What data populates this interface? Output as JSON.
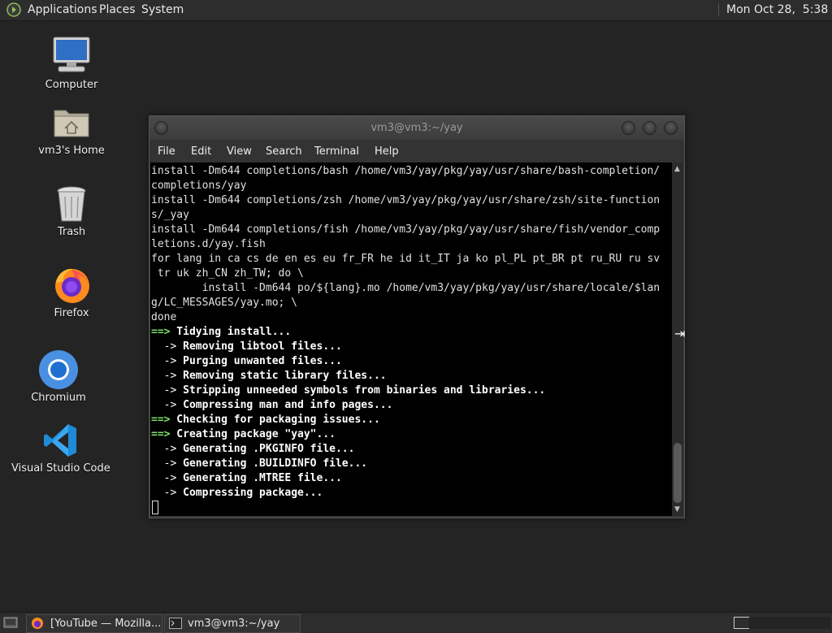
{
  "top_panel": {
    "menus": [
      "Applications",
      "Places",
      "System"
    ],
    "clock": "Mon Oct 28,  5:38 AM"
  },
  "desktop": {
    "icons": [
      {
        "label": "Computer",
        "icon": "computer-icon"
      },
      {
        "label": "vm3's Home",
        "icon": "home-folder-icon"
      },
      {
        "label": "Trash",
        "icon": "trash-icon"
      },
      {
        "label": "Firefox",
        "icon": "firefox-icon"
      },
      {
        "label": "Chromium",
        "icon": "chromium-icon"
      },
      {
        "label": "Visual Studio Code",
        "icon": "vscode-icon"
      }
    ]
  },
  "terminal": {
    "title": "vm3@vm3:~/yay",
    "menu": [
      "File",
      "Edit",
      "View",
      "Search",
      "Terminal",
      "Help"
    ],
    "lines": [
      {
        "text": "install -Dm644 completions/bash /home/vm3/yay/pkg/yay/usr/share/bash-completion/",
        "style": "plain"
      },
      {
        "text": "completions/yay",
        "style": "plain"
      },
      {
        "text": "install -Dm644 completions/zsh /home/vm3/yay/pkg/yay/usr/share/zsh/site-function",
        "style": "plain"
      },
      {
        "text": "s/_yay",
        "style": "plain"
      },
      {
        "text": "install -Dm644 completions/fish /home/vm3/yay/pkg/yay/usr/share/fish/vendor_comp",
        "style": "plain"
      },
      {
        "text": "letions.d/yay.fish",
        "style": "plain"
      },
      {
        "text": "for lang in ca cs de en es eu fr_FR he id it_IT ja ko pl_PL pt_BR pt ru_RU ru sv",
        "style": "plain"
      },
      {
        "text": " tr uk zh_CN zh_TW; do \\",
        "style": "plain"
      },
      {
        "text": "        install -Dm644 po/${lang}.mo /home/vm3/yay/pkg/yay/usr/share/locale/$lan",
        "style": "plain"
      },
      {
        "text": "g/LC_MESSAGES/yay.mo; \\",
        "style": "plain"
      },
      {
        "text": "done",
        "style": "plain"
      },
      {
        "prefix": "==>",
        "text": " Tidying install...",
        "style": "major"
      },
      {
        "prefix": "  ->",
        "text": " Removing libtool files...",
        "style": "minor"
      },
      {
        "prefix": "  ->",
        "text": " Purging unwanted files...",
        "style": "minor"
      },
      {
        "prefix": "  ->",
        "text": " Removing static library files...",
        "style": "minor"
      },
      {
        "prefix": "  ->",
        "text": " Stripping unneeded symbols from binaries and libraries...",
        "style": "minor"
      },
      {
        "prefix": "  ->",
        "text": " Compressing man and info pages...",
        "style": "minor"
      },
      {
        "prefix": "==>",
        "text": " Checking for packaging issues...",
        "style": "major"
      },
      {
        "prefix": "==>",
        "text": " Creating package \"yay\"...",
        "style": "major"
      },
      {
        "prefix": "  ->",
        "text": " Generating .PKGINFO file...",
        "style": "minor"
      },
      {
        "prefix": "  ->",
        "text": " Generating .BUILDINFO file...",
        "style": "minor"
      },
      {
        "prefix": "  ->",
        "text": " Generating .MTREE file...",
        "style": "minor"
      },
      {
        "prefix": "  ->",
        "text": " Compressing package...",
        "style": "minor"
      }
    ]
  },
  "taskbar": {
    "tasks": [
      "[YouTube — Mozilla...",
      "vm3@vm3:~/yay"
    ]
  },
  "colors": {
    "desktop_bg": "#242424",
    "panel_bg": "#2d2d2d",
    "arrow_green": "#7fe36b",
    "terminal_bg": "#000000"
  }
}
